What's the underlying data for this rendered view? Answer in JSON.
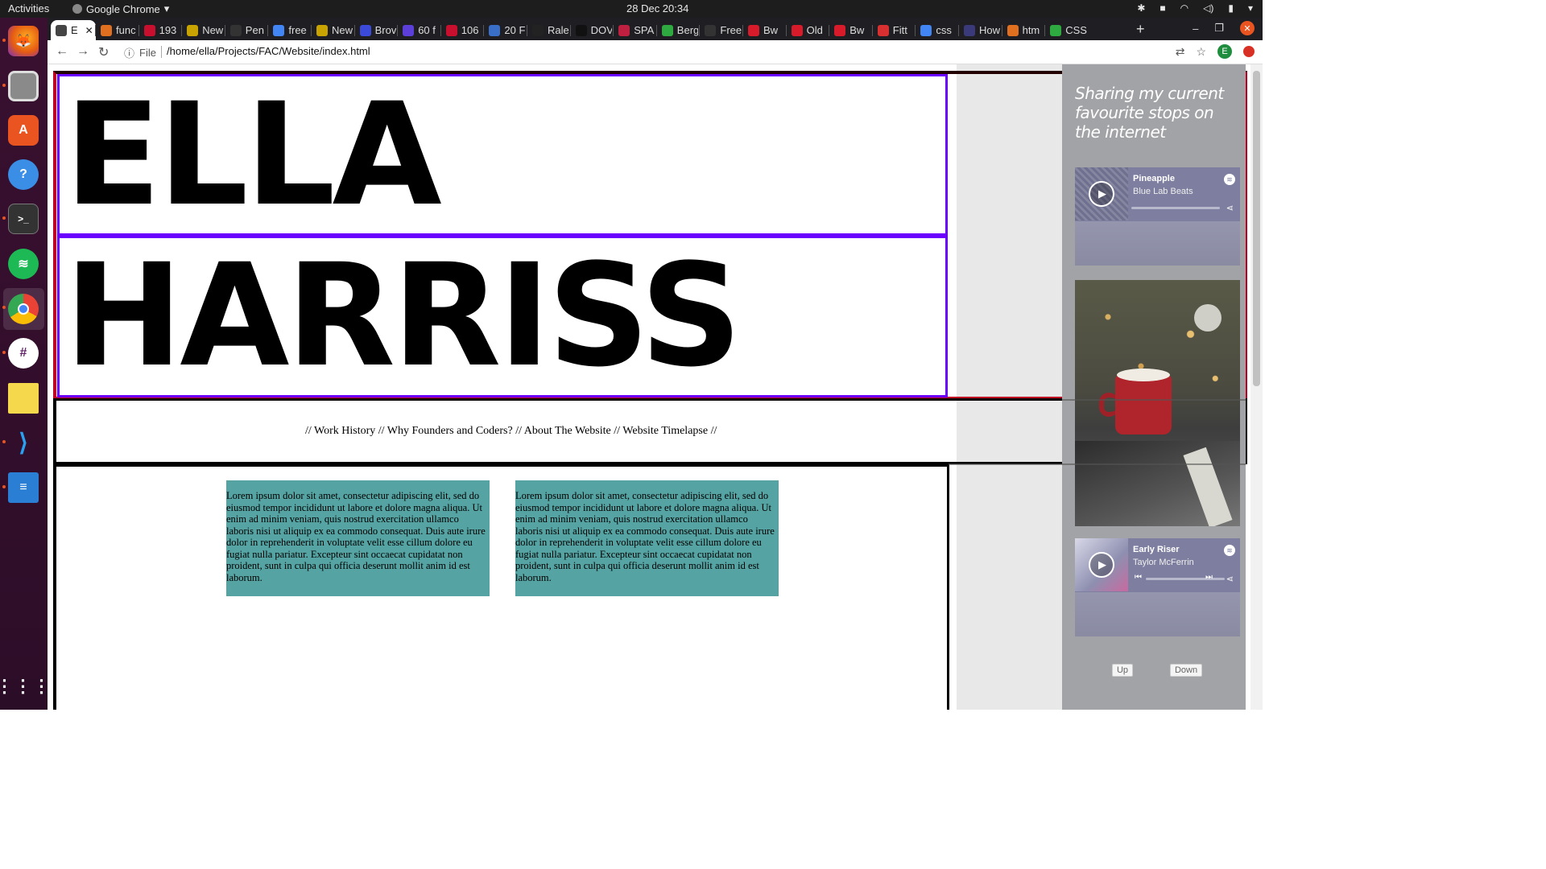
{
  "topbar": {
    "activities": "Activities",
    "app_name": "Google Chrome",
    "clock": "28 Dec  20:34"
  },
  "dock": {
    "apps": [
      "Firefox",
      "Files",
      "Ubuntu Software",
      "Help",
      "Terminal",
      "Spotify",
      "Google Chrome",
      "Slack",
      "Sticky Notes",
      "Visual Studio Code",
      "LibreOffice Writer",
      "Show Applications"
    ]
  },
  "tabs": [
    {
      "label": "E",
      "color": "#444"
    },
    {
      "label": "func",
      "color": "#e07020"
    },
    {
      "label": "193",
      "color": "#c8102e"
    },
    {
      "label": "New",
      "color": "#c9a400"
    },
    {
      "label": "Pen",
      "color": "#333"
    },
    {
      "label": "free",
      "color": "#4285f4"
    },
    {
      "label": "New",
      "color": "#c9a400"
    },
    {
      "label": "Brov",
      "color": "#3b4ad8"
    },
    {
      "label": "60 f",
      "color": "#5b3fd8"
    },
    {
      "label": "106",
      "color": "#c8102e"
    },
    {
      "label": "20 F",
      "color": "#3a6fc8"
    },
    {
      "label": "Rale",
      "color": "#222"
    },
    {
      "label": "DOV",
      "color": "#111"
    },
    {
      "label": "SPA",
      "color": "#c02040"
    },
    {
      "label": "Berg",
      "color": "#2faa40"
    },
    {
      "label": "Free",
      "color": "#333"
    },
    {
      "label": "Bw",
      "color": "#d81b2a"
    },
    {
      "label": "Old",
      "color": "#d81b2a"
    },
    {
      "label": "Bw",
      "color": "#d81b2a"
    },
    {
      "label": "Fitt",
      "color": "#d83030"
    },
    {
      "label": "css",
      "color": "#4285f4"
    },
    {
      "label": "How",
      "color": "#3a3a7a"
    },
    {
      "label": "htm",
      "color": "#e07020"
    },
    {
      "label": "CSS",
      "color": "#2faa40"
    }
  ],
  "toolbar": {
    "file_label": "File",
    "url": "/home/ella/Projects/FAC/Website/index.html",
    "profile_initial": "E"
  },
  "page": {
    "name_first": "ELLA",
    "name_last": "HARRISS",
    "nav_text": "// Work History // Why Founders and Coders? // About The Website // Website Timelapse //",
    "cards": [
      "Lorem ipsum dolor sit amet, consectetur adipiscing elit, sed do eiusmod tempor incididunt ut labore et dolore magna aliqua. Ut enim ad minim veniam, quis nostrud exercitation ullamco laboris nisi ut aliquip ex ea commodo consequat. Duis aute irure dolor in reprehenderit in voluptate velit esse cillum dolore eu fugiat nulla pariatur. Excepteur sint occaecat cupidatat non proident, sunt in culpa qui officia deserunt mollit anim id est laborum.",
      "Lorem ipsum dolor sit amet, consectetur adipiscing elit, sed do eiusmod tempor incididunt ut labore et dolore magna aliqua. Ut enim ad minim veniam, quis nostrud exercitation ullamco laboris nisi ut aliquip ex ea commodo consequat. Duis aute irure dolor in reprehenderit in voluptate velit esse cillum dolore eu fugiat nulla pariatur. Excepteur sint occaecat cupidatat non proident, sunt in culpa qui officia deserunt mollit anim id est laborum."
    ],
    "card_color": "#55a3a2"
  },
  "sidebar": {
    "title": "Sharing my current favourite stops on the internet",
    "track_1": {
      "title": "Pineapple",
      "artist": "Blue Lab Beats"
    },
    "track_2": {
      "title": "Early Riser",
      "artist": "Taylor McFerrin"
    },
    "btn_up": "Up",
    "btn_down": "Down"
  }
}
